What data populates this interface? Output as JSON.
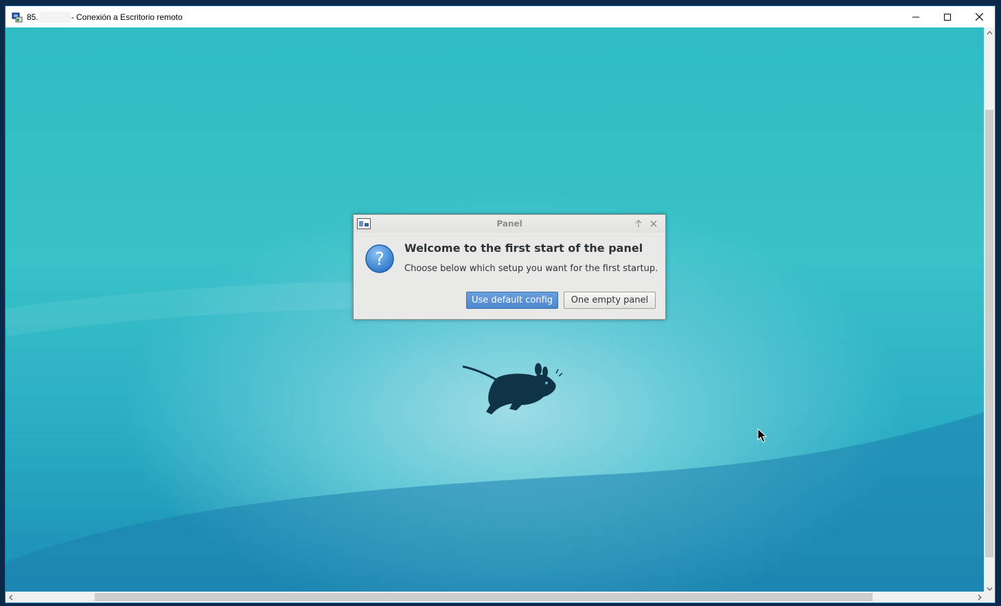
{
  "rdp": {
    "title_prefix": "85.",
    "title_suffix": "- Conexión a Escritorio remoto",
    "icons": {
      "app": "remote-desktop-icon",
      "minimize": "minimize-icon",
      "maximize": "maximize-icon",
      "close": "close-icon"
    }
  },
  "dialog": {
    "title": "Panel",
    "heading": "Welcome to the first start of the panel",
    "message": "Choose below which setup you want for the first startup.",
    "buttons": {
      "default_config": "Use default config",
      "empty_panel": "One empty panel"
    },
    "icons": {
      "app": "panel-icon",
      "question": "question-icon",
      "keep_above": "arrow-up-icon",
      "close": "close-icon"
    }
  },
  "desktop": {
    "logo": "xfce-mouse-logo",
    "cursor": "mouse-cursor-icon"
  },
  "colors": {
    "accent": "#4d88cf",
    "desktop_light": "#9edce6",
    "desktop_dark": "#1b8cb3"
  }
}
